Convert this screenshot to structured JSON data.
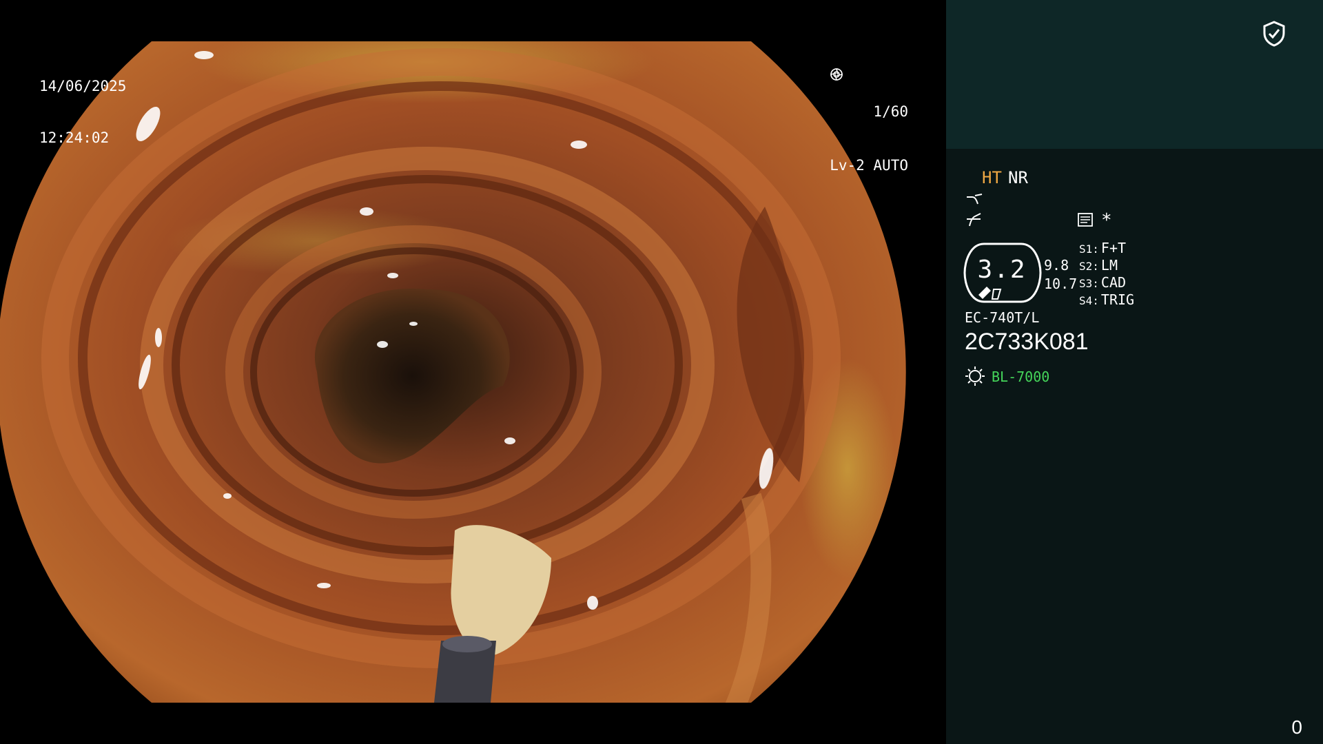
{
  "overlay": {
    "date": "14/06/2025",
    "time": "12:24:02",
    "shutter": "1/60",
    "iris_mode": "Lv-2 AUTO"
  },
  "panel": {
    "enhancement": "HT",
    "noise_reduction": "NR",
    "star": "*",
    "gauge_value": "3.2",
    "value_a": "9.8",
    "value_b": "10.7",
    "switches": [
      {
        "key": "S1:",
        "value": "F+T"
      },
      {
        "key": "S2:",
        "value": "LM"
      },
      {
        "key": "S3:",
        "value": "CAD"
      },
      {
        "key": "S4:",
        "value": "TRIG"
      }
    ],
    "model": "EC-740T/L",
    "serial": "2C733K081",
    "light_source": "BL-7000",
    "counter": "0"
  },
  "colors": {
    "panel_bg": "#0a1616",
    "panel_header": "#0e2727",
    "ht": "#f0a844",
    "light_source": "#45d65a"
  },
  "icons": [
    "shield-check-icon",
    "gamma-curve-icon",
    "contrast-curve-icon",
    "memo-icon",
    "light-source-icon",
    "shutter-icon",
    "iris-icon"
  ]
}
